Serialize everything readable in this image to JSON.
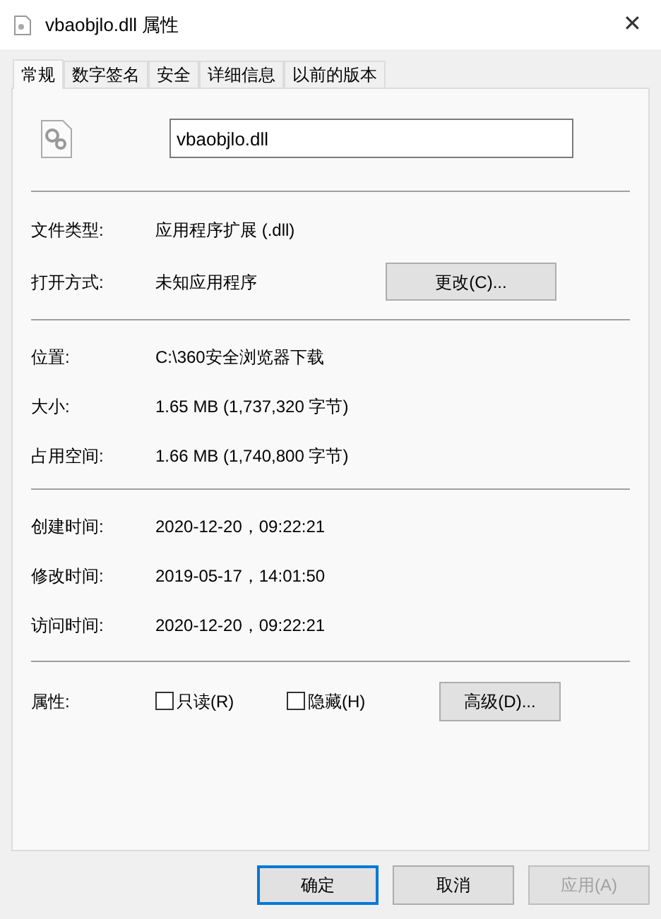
{
  "window": {
    "title": "vbaobjlo.dll 属性",
    "close": "✕"
  },
  "tabs": [
    {
      "label": "常规",
      "selected": true
    },
    {
      "label": "数字签名",
      "selected": false
    },
    {
      "label": "安全",
      "selected": false
    },
    {
      "label": "详细信息",
      "selected": false
    },
    {
      "label": "以前的版本",
      "selected": false
    }
  ],
  "name_field": {
    "value": "vbaobjlo.dll"
  },
  "type_section": [
    {
      "label": "文件类型:",
      "value": "应用程序扩展 (.dll)"
    },
    {
      "label": "打开方式:",
      "value": "未知应用程序",
      "button": "更改(C)..."
    }
  ],
  "location_section": [
    {
      "label": "位置:",
      "value": "C:\\360安全浏览器下载"
    },
    {
      "label": "大小:",
      "value": "1.65 MB (1,737,320 字节)"
    },
    {
      "label": "占用空间:",
      "value": "1.66 MB (1,740,800 字节)"
    }
  ],
  "time_section": [
    {
      "label": "创建时间:",
      "value": "2020-12-20，09:22:21"
    },
    {
      "label": "修改时间:",
      "value": "2019-05-17，14:01:50"
    },
    {
      "label": "访问时间:",
      "value": "2020-12-20，09:22:21"
    }
  ],
  "attributes": {
    "label": "属性:",
    "checkboxes": [
      {
        "label": "只读(R)",
        "checked": false
      },
      {
        "label": "隐藏(H)",
        "checked": false
      }
    ],
    "button": "高级(D)..."
  },
  "footer_buttons": [
    {
      "label": "确定",
      "kind": "default",
      "disabled": false
    },
    {
      "label": "取消",
      "kind": "normal",
      "disabled": false
    },
    {
      "label": "应用(A)",
      "kind": "normal",
      "disabled": true
    }
  ]
}
